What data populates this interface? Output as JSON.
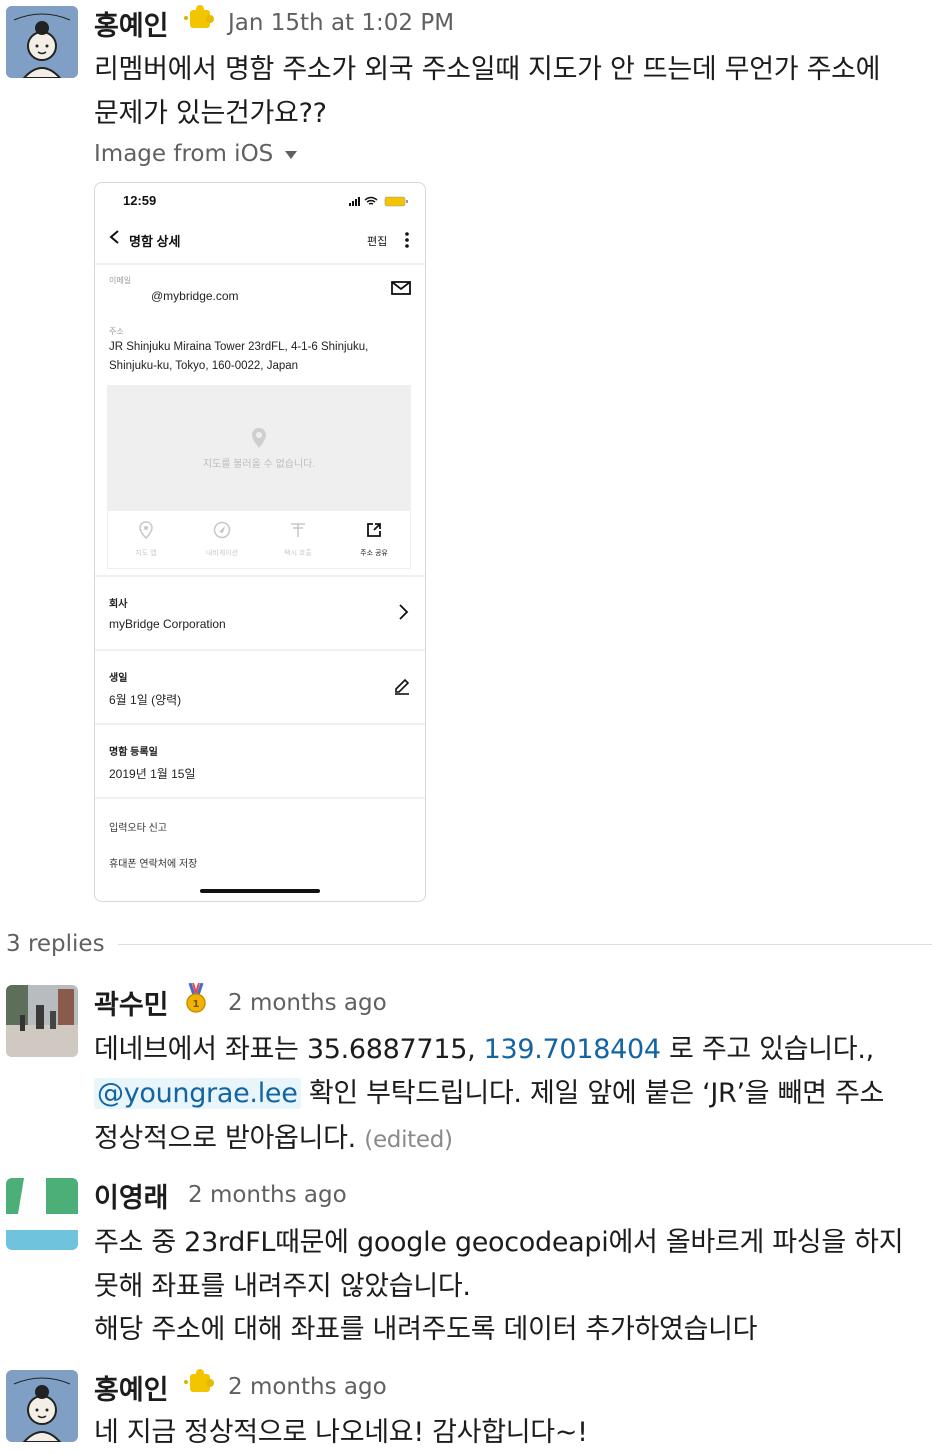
{
  "original_post": {
    "author": "홍예인",
    "badge_icon": "yellow-puzzle-emoji",
    "timestamp": "Jan 15th at 1:02 PM",
    "lines": [
      "리멤버에서 명함 주소가 외국 주소일때 지도가 안 뜨는데 무언가 주소에",
      "문제가 있는건가요??"
    ],
    "file_label": "Image from iOS"
  },
  "phone": {
    "time": "12:59",
    "title": "명함 상세",
    "edit": "편집",
    "email_label": "이메일",
    "email_value": "@mybridge.com",
    "address_label": "주소",
    "address_lines": [
      "JR Shinjuku Miraina Tower 23rdFL, 4-1-6 Shinjuku,",
      "Shinjuku-ku, Tokyo, 160-0022, Japan"
    ],
    "map_message": "지도를 불러올 수 없습니다.",
    "actions": [
      "지도 앱",
      "내비게이션",
      "택시 호출",
      "주소 공유"
    ],
    "company_label": "회사",
    "company_value": "myBridge Corporation",
    "birthday_label": "생일",
    "birthday_value": "6월 1일 (양력)",
    "registered_label": "명함 등록일",
    "registered_value": "2019년 1월 15일",
    "report_link": "입력오타 신고",
    "save_link": "휴대폰 연락처에 저장"
  },
  "thread": {
    "replies_label": "3 replies"
  },
  "replies": [
    {
      "author": "곽수민",
      "badge_icon": "gold-medal-emoji",
      "timestamp": "2 months ago",
      "line1_prefix": "데네브에서 좌표는 35.6887715, ",
      "line1_link": "139.7018404",
      "line1_suffix": " 로 주고 있습니다.,",
      "line2_mention": "@youngrae.lee",
      "line2_rest": " 확인 부탁드립니다. 제일 앞에 붙은 ‘JR’을 빼면 주소",
      "line3": "정상적으로 받아옵니다.",
      "edited": "(edited)"
    },
    {
      "author": "이영래",
      "timestamp": "2 months ago",
      "lines": [
        "주소 중 23rdFL때문에 google geocodeapi에서 올바르게 파싱을 하지",
        "못해 좌표를 내려주지 않았습니다.",
        "해당 주소에 대해 좌표를 내려주도록 데이터 추가하였습니다"
      ]
    },
    {
      "author": "홍예인",
      "badge_icon": "yellow-puzzle-emoji",
      "timestamp": "2 months ago",
      "lines": [
        "네 지금 정상적으로 나오네요! 감사합니다~!"
      ]
    }
  ],
  "colors": {
    "link": "#1264a3",
    "text": "#1d1c1d",
    "muted": "#616061",
    "avatar_green": "#4caf78",
    "avatar_blue": "#6fc3dc"
  }
}
